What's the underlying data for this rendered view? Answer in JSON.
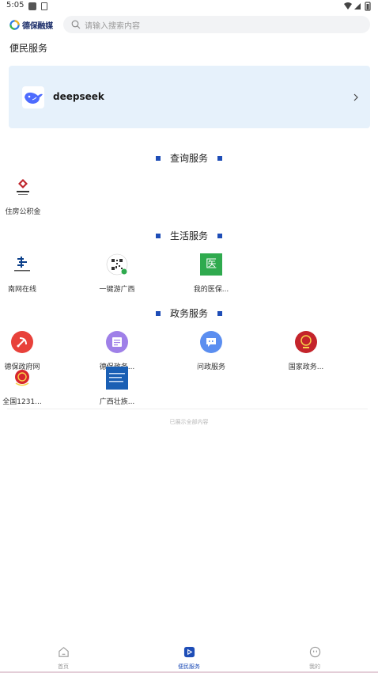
{
  "status_bar": {
    "time": "5:05"
  },
  "header": {
    "logo_text": "德保融媒",
    "search_placeholder": "请输入搜索内容"
  },
  "page_title": "便民服务",
  "featured": {
    "name": "deepseek"
  },
  "sections": {
    "query": {
      "title": "查询服务",
      "items": [
        {
          "label": "住房公积金",
          "icon": "housing-fund-icon"
        }
      ]
    },
    "life": {
      "title": "生活服务",
      "items": [
        {
          "label": "南网在线",
          "icon": "china-southern-grid-icon"
        },
        {
          "label": "一键游广西",
          "icon": "qr-code-icon"
        },
        {
          "label": "我的医保...",
          "icon": "medical-insurance-icon",
          "icon_text": "医"
        }
      ]
    },
    "gov": {
      "title": "政务服务",
      "items": [
        {
          "label": "德保政府网",
          "icon": "party-emblem-icon"
        },
        {
          "label": "德保政务...",
          "icon": "document-icon"
        },
        {
          "label": "问政服务",
          "icon": "chat-bubble-icon"
        },
        {
          "label": "国家政务...",
          "icon": "national-emblem-icon"
        },
        {
          "label": "全国1231...",
          "icon": "national-emblem-small-icon"
        },
        {
          "label": "广西壮族...",
          "icon": "gx-gov-banner-icon"
        }
      ]
    }
  },
  "end_note": "已展示全部内容",
  "nav": {
    "home": "首页",
    "services": "便民服务",
    "mine": "我的"
  },
  "colors": {
    "accent": "#1e4db7",
    "card_bg": "#e6f1fb",
    "medical_green": "#2faa4e"
  }
}
